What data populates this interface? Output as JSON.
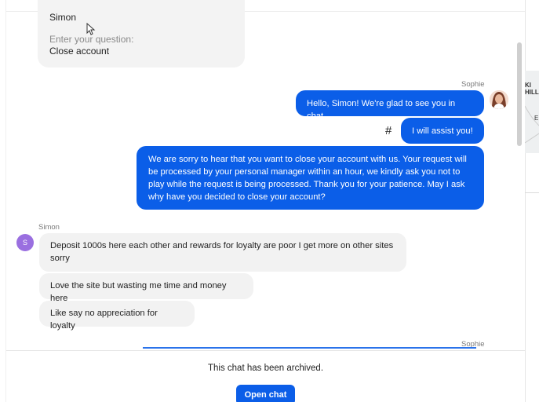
{
  "previous_card": {
    "name": "Simon",
    "question_label": "Enter your question:",
    "question_value": "Close account"
  },
  "agent": {
    "name": "Sophie",
    "messages": [
      "Hello, Simon! We're glad to see you in chat.",
      "I will assist you!",
      "We are sorry to hear that you want to close your account with us. Your request will be processed by your personal manager within an hour, we kindly ask you not to play while the request is being processed. Thank you for your patience. May I ask why have you decided to close your account?"
    ],
    "hash_symbol": "#"
  },
  "customer": {
    "name": "Simon",
    "initial": "S",
    "messages": [
      "Deposit 1000s here each other and rewards for loyalty are poor I get more on other sites sorry",
      "Love the site but wasting me time and money here",
      "Like say no appreciation for loyalty"
    ]
  },
  "next_sender": "Sophie",
  "footer": {
    "archived_text": "This chat has been archived.",
    "open_button": "Open chat"
  },
  "map": {
    "labels": [
      "KI",
      "HILL",
      "E"
    ]
  },
  "colors": {
    "accent": "#0b5ee8",
    "incoming_bubble": "#f2f2f2",
    "avatar_initial_bg": "#9a6fe0"
  }
}
